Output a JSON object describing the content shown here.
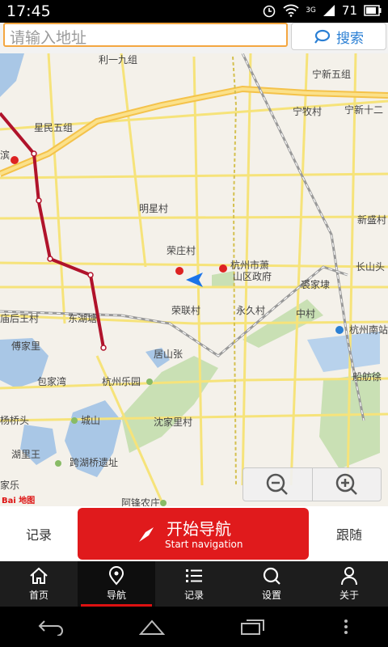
{
  "status": {
    "time": "17:45",
    "signal": "3G",
    "battery": "71"
  },
  "search": {
    "placeholder": "请输入地址",
    "button": "搜索"
  },
  "map": {
    "labels": [
      "利一九组",
      "宁新五组",
      "宁牧村",
      "宁新十二",
      "星民五组",
      "明星村",
      "新盛村",
      "荣庄村",
      "杭州市萧",
      "山区政府",
      "裘家埭",
      "长山头",
      "庙后王村",
      "东湖塘",
      "荣联村",
      "永久村",
      "中村",
      "杭州南站",
      "傅家里",
      "居山张",
      "包家湾",
      "杭州乐园",
      "船舫徐",
      "杨桥头",
      "城山",
      "沈家里村",
      "湖里王",
      "跨湖桥遗址",
      "阿锋农庄",
      "滨",
      "家乐"
    ],
    "brand": "Bai 地图"
  },
  "actions": {
    "left": "记录",
    "start_cn": "开始导航",
    "start_en": "Start navigation",
    "right": "跟随"
  },
  "tabs": [
    {
      "label": "首页",
      "icon": "home-icon"
    },
    {
      "label": "导航",
      "icon": "location-pin-icon"
    },
    {
      "label": "记录",
      "icon": "list-icon"
    },
    {
      "label": "设置",
      "icon": "search-settings-icon"
    },
    {
      "label": "关于",
      "icon": "person-icon"
    }
  ],
  "active_tab": "导航",
  "colors": {
    "accent": "#e01a1c",
    "search_border": "#f4a640",
    "link": "#2a7fd4"
  }
}
